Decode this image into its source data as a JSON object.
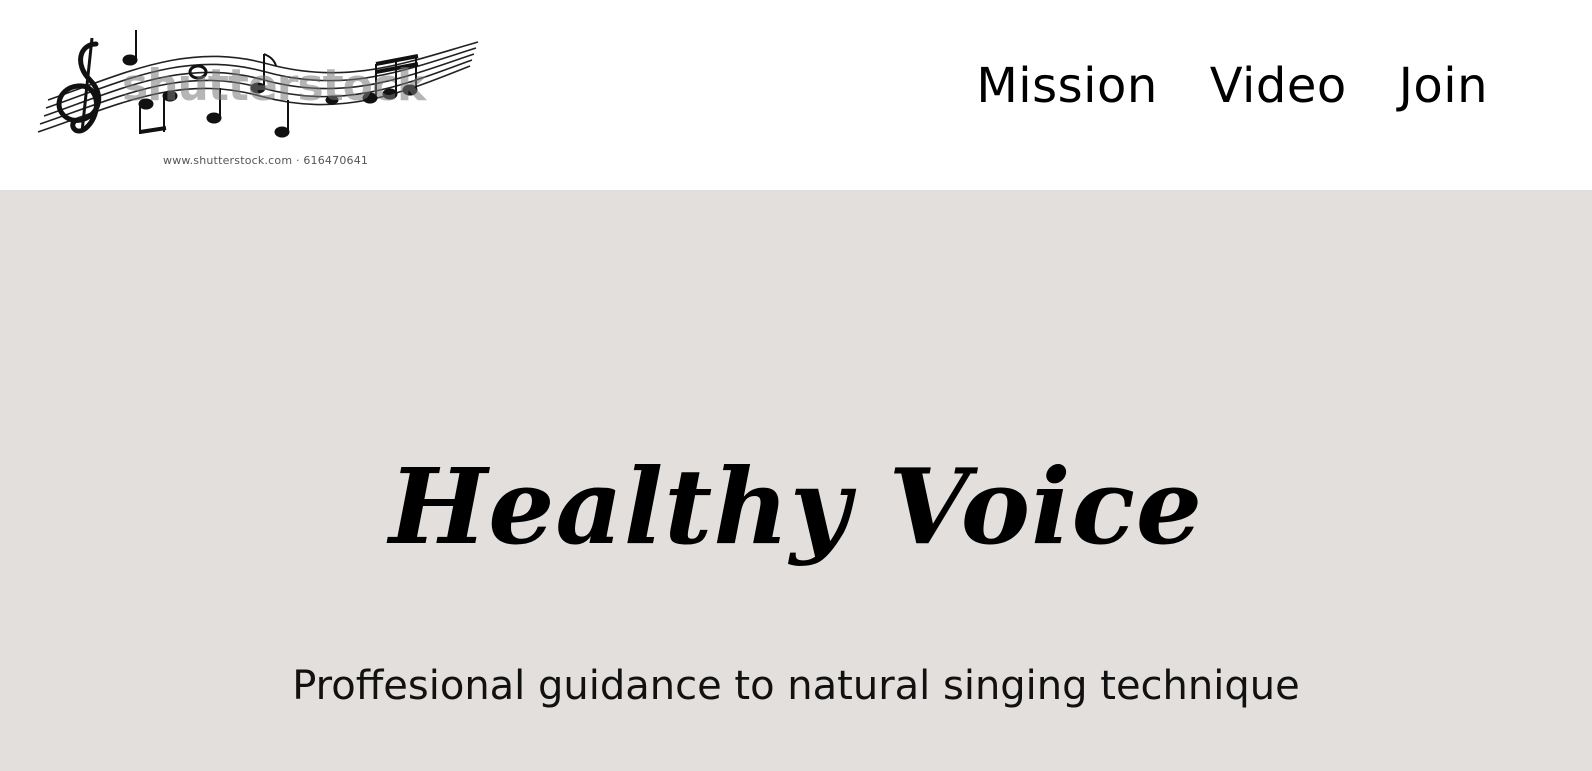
{
  "header": {
    "logo": {
      "watermark_text": "shutterstock",
      "caption": "www.shutterstock.com · 616470641",
      "icon": "music-staff-notes-icon"
    },
    "nav": {
      "items": [
        {
          "label": "Mission"
        },
        {
          "label": "Video"
        },
        {
          "label": "Join"
        }
      ]
    }
  },
  "hero": {
    "title": "Healthy Voice",
    "subtitle": "Proffesional guidance to natural singing technique",
    "background": "#e2dfdc"
  }
}
